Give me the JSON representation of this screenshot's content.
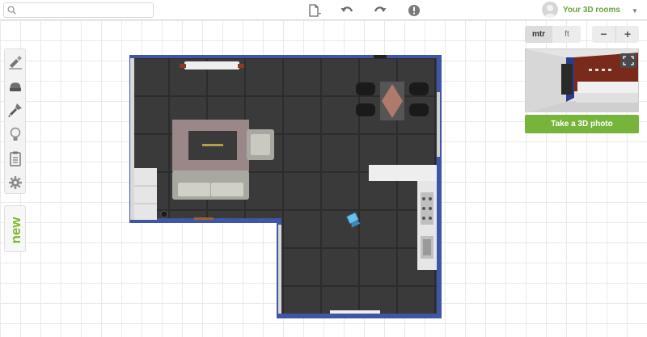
{
  "topbar": {
    "search_value": "",
    "icons": [
      "search-icon",
      "new-document-icon",
      "undo-icon",
      "redo-icon",
      "help-icon"
    ],
    "account_name": "Your 3D rooms",
    "account_caret": "▼"
  },
  "left_toolbar": {
    "tools": [
      "draw-walls-icon",
      "furniture-icon",
      "paint-icon",
      "lighting-icon",
      "clipboard-icon",
      "settings-icon"
    ],
    "new_label": "new"
  },
  "right_panel": {
    "units": [
      "mtr",
      "ft"
    ],
    "active_unit": "mtr",
    "zoom_out": "−",
    "zoom_in": "+",
    "photo_button": "Take a 3D photo"
  },
  "colors": {
    "accent": "#77b53a",
    "wall": "#3f56a8",
    "floor": "#3b3b3b"
  }
}
